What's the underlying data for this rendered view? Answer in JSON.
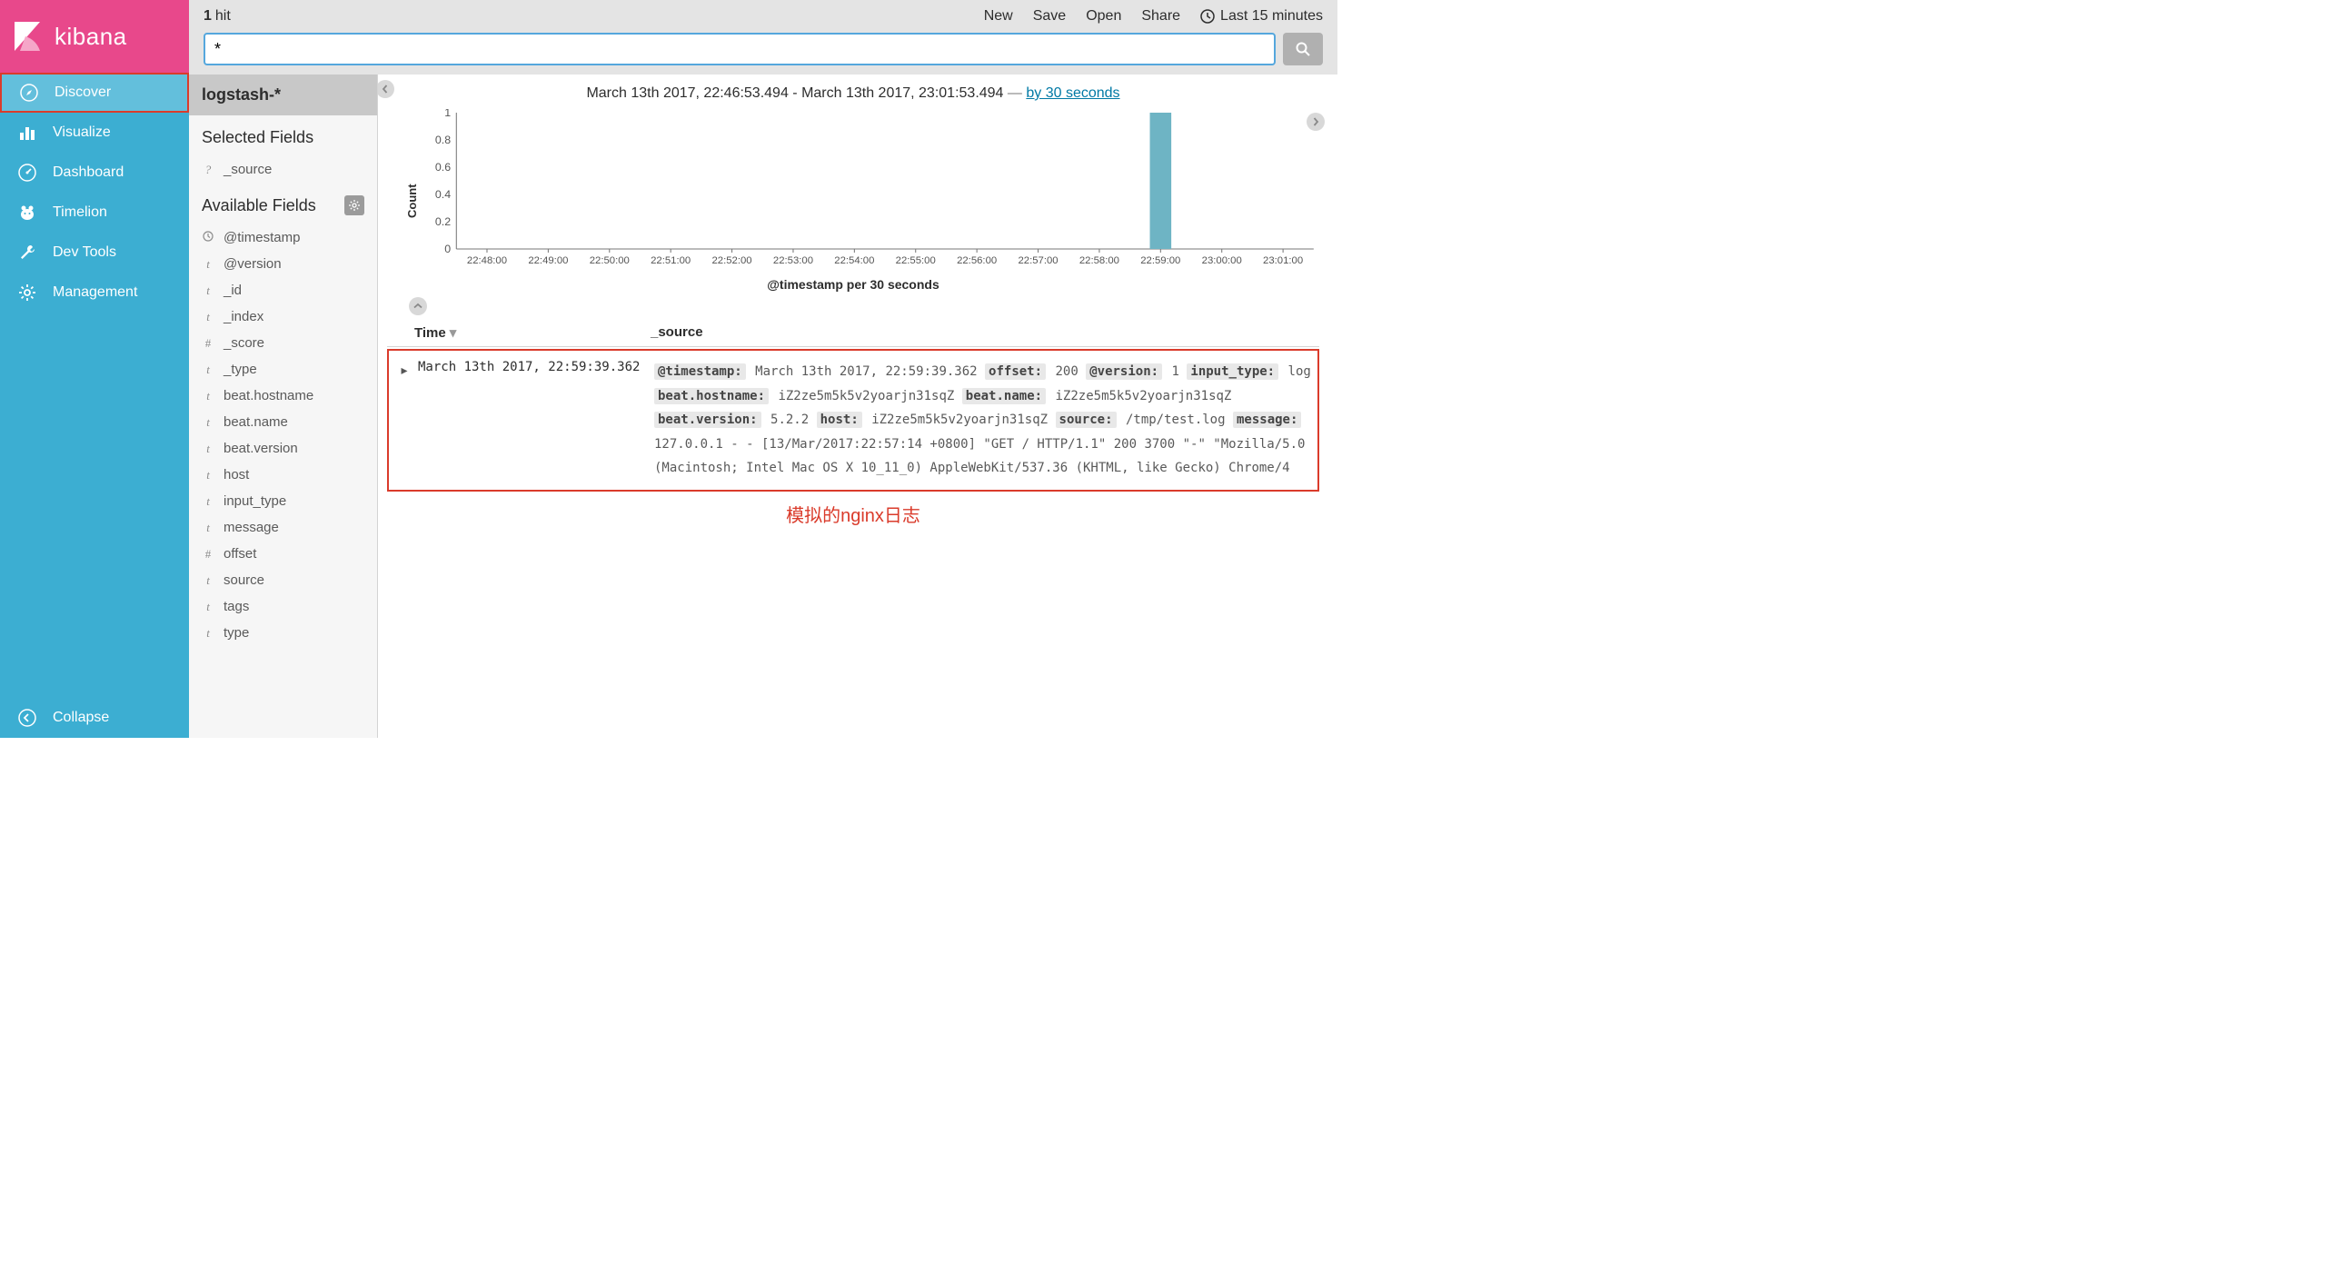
{
  "logo": {
    "text": "kibana"
  },
  "nav": {
    "items": [
      {
        "label": "Discover",
        "icon": "compass",
        "active": true
      },
      {
        "label": "Visualize",
        "icon": "bar-chart",
        "active": false
      },
      {
        "label": "Dashboard",
        "icon": "gauge",
        "active": false
      },
      {
        "label": "Timelion",
        "icon": "bear",
        "active": false
      },
      {
        "label": "Dev Tools",
        "icon": "wrench",
        "active": false
      },
      {
        "label": "Management",
        "icon": "gear",
        "active": false
      }
    ],
    "collapse": "Collapse"
  },
  "topbar": {
    "hit_count": "1",
    "hit_label": "hit",
    "links": {
      "new": "New",
      "save": "Save",
      "open": "Open",
      "share": "Share",
      "time": "Last 15 minutes"
    }
  },
  "search": {
    "value": "*"
  },
  "fields_panel": {
    "index_pattern": "logstash-*",
    "selected_title": "Selected Fields",
    "selected": [
      {
        "type": "?",
        "name": "_source"
      }
    ],
    "available_title": "Available Fields",
    "available": [
      {
        "type": "clock",
        "name": "@timestamp"
      },
      {
        "type": "t",
        "name": "@version"
      },
      {
        "type": "t",
        "name": "_id"
      },
      {
        "type": "t",
        "name": "_index"
      },
      {
        "type": "#",
        "name": "_score"
      },
      {
        "type": "t",
        "name": "_type"
      },
      {
        "type": "t",
        "name": "beat.hostname"
      },
      {
        "type": "t",
        "name": "beat.name"
      },
      {
        "type": "t",
        "name": "beat.version"
      },
      {
        "type": "t",
        "name": "host"
      },
      {
        "type": "t",
        "name": "input_type"
      },
      {
        "type": "t",
        "name": "message"
      },
      {
        "type": "#",
        "name": "offset"
      },
      {
        "type": "t",
        "name": "source"
      },
      {
        "type": "t",
        "name": "tags"
      },
      {
        "type": "t",
        "name": "type"
      }
    ]
  },
  "time_range": {
    "from": "March 13th 2017, 22:46:53.494",
    "to": "March 13th 2017, 23:01:53.494",
    "dash": "—",
    "link": "by 30 seconds"
  },
  "chart_data": {
    "type": "bar",
    "ylabel": "Count",
    "xlabel": "@timestamp per 30 seconds",
    "ylim": [
      0,
      1
    ],
    "yticks": [
      0,
      0.2,
      0.4,
      0.6,
      0.8,
      1
    ],
    "xticks": [
      "22:48:00",
      "22:49:00",
      "22:50:00",
      "22:51:00",
      "22:52:00",
      "22:53:00",
      "22:54:00",
      "22:55:00",
      "22:56:00",
      "22:57:00",
      "22:58:00",
      "22:59:00",
      "23:00:00",
      "23:01:00"
    ],
    "categories": [
      "22:48:00",
      "22:49:00",
      "22:50:00",
      "22:51:00",
      "22:52:00",
      "22:53:00",
      "22:54:00",
      "22:55:00",
      "22:56:00",
      "22:57:00",
      "22:58:00",
      "22:59:00",
      "23:00:00",
      "23:01:00"
    ],
    "values": [
      0,
      0,
      0,
      0,
      0,
      0,
      0,
      0,
      0,
      0,
      0,
      1,
      0,
      0
    ]
  },
  "table": {
    "headers": {
      "time": "Time",
      "source": "_source"
    },
    "rows": [
      {
        "time": "March 13th 2017, 22:59:39.362",
        "kv": [
          {
            "k": "@timestamp:",
            "v": "March 13th 2017, 22:59:39.362"
          },
          {
            "k": "offset:",
            "v": "200"
          },
          {
            "k": "@version:",
            "v": "1"
          },
          {
            "k": "input_type:",
            "v": "log"
          },
          {
            "k": "beat.hostname:",
            "v": "iZ2ze5m5k5v2yoarjn31sqZ"
          },
          {
            "k": "beat.name:",
            "v": "iZ2ze5m5k5v2yoarjn31sqZ"
          },
          {
            "k": "beat.version:",
            "v": "5.2.2"
          },
          {
            "k": "host:",
            "v": "iZ2ze5m5k5v2yoarjn31sqZ"
          },
          {
            "k": "source:",
            "v": "/tmp/test.log"
          },
          {
            "k": "message:",
            "v": "127.0.0.1 - - [13/Mar/2017:22:57:14 +0800] \"GET / HTTP/1.1\" 200 3700 \"-\" \"Mozilla/5.0 (Macintosh; Intel Mac OS X 10_11_0) AppleWebKit/537.36 (KHTML, like Gecko) Chrome/4"
          }
        ]
      }
    ]
  },
  "annotation": "模拟的nginx日志"
}
